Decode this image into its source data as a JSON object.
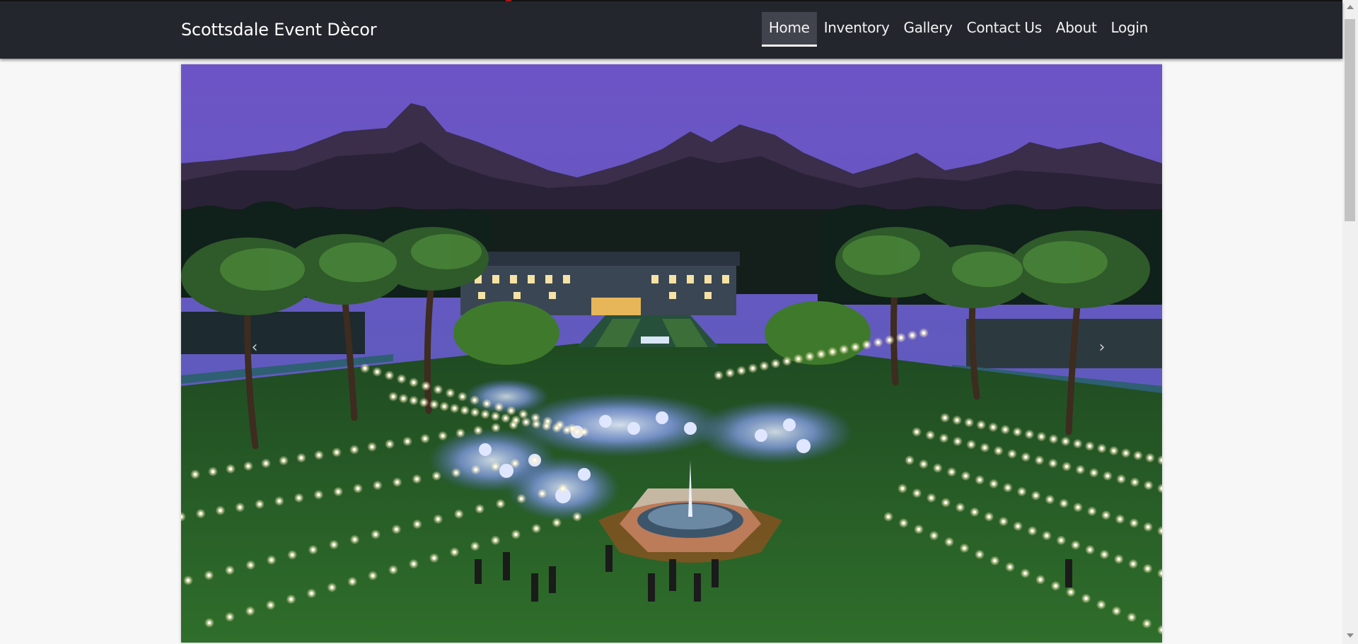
{
  "brand": {
    "name": "Scottsdale Event Dècor"
  },
  "nav": {
    "items": [
      {
        "label": "Home",
        "active": true
      },
      {
        "label": "Inventory"
      },
      {
        "label": "Gallery"
      },
      {
        "label": "Contact Us"
      },
      {
        "label": "About"
      },
      {
        "label": "Login"
      }
    ]
  },
  "carousel": {
    "prev_icon": "chevron-left",
    "next_icon": "chevron-right",
    "prev_glyph": "‹",
    "next_glyph": "›",
    "slide_image": "evening event on lawn with string lights, fountain and palm trees under mountains"
  },
  "colors": {
    "navbar_bg": "#24262d",
    "page_bg": "#f7f7f7",
    "active_tab_bg": "#41444d",
    "sky_top": "#6d54c6",
    "sky_bottom": "#3d4b9b",
    "lawn": "#2e6b2a",
    "string_light": "#fff4c4"
  }
}
